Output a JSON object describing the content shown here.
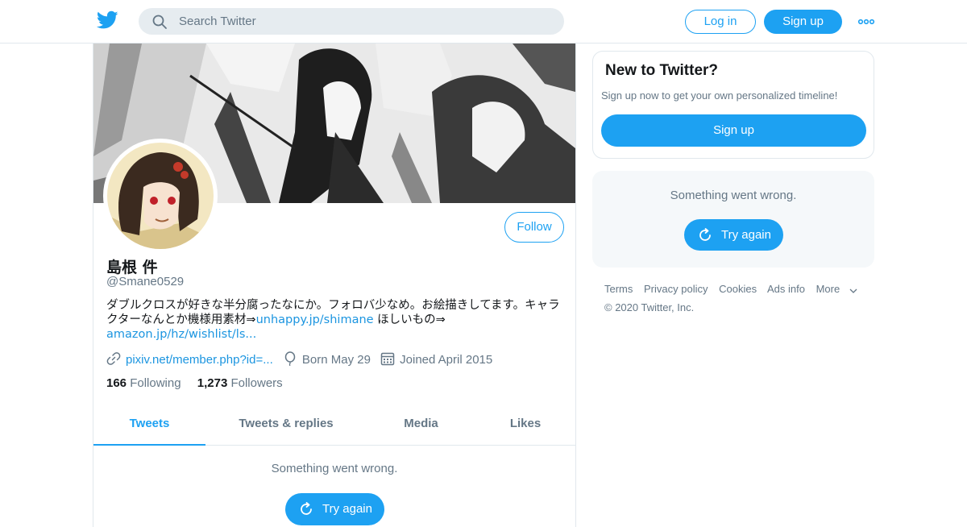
{
  "header": {
    "search_placeholder": "Search Twitter",
    "login_label": "Log in",
    "signup_label": "Sign up",
    "brand_color": "#1da1f2"
  },
  "profile": {
    "name": "島根 件",
    "handle": "@Smane0529",
    "bio_text": "ダブルクロスが好きな半分腐ったなにか。フォロバ少なめ。お絵描きしてます。キャラクターなんとか機様用素材⇒",
    "bio_link1": "unhappy.jp/shimane",
    "bio_mid": " ほしいもの⇒",
    "bio_link2": "amazon.jp/hz/wishlist/ls...",
    "website": "pixiv.net/member.php?id=...",
    "birthday": "Born May 29",
    "joined": "Joined April 2015",
    "following_count": "166",
    "following_label": "Following",
    "followers_count": "1,273",
    "followers_label": "Followers",
    "follow_label": "Follow"
  },
  "tabs": [
    {
      "label": "Tweets",
      "active": true
    },
    {
      "label": "Tweets & replies",
      "active": false
    },
    {
      "label": "Media",
      "active": false
    },
    {
      "label": "Likes",
      "active": false
    }
  ],
  "timeline": {
    "error_message": "Something went wrong.",
    "retry_label": "Try again"
  },
  "sidebar": {
    "new_title": "New to Twitter?",
    "new_subtitle": "Sign up now to get your own personalized timeline!",
    "signup_label": "Sign up",
    "error_message": "Something went wrong.",
    "retry_label": "Try again"
  },
  "footer": {
    "links": [
      "Terms",
      "Privacy policy",
      "Cookies",
      "Ads info",
      "More"
    ],
    "copyright": "© 2020 Twitter, Inc."
  }
}
